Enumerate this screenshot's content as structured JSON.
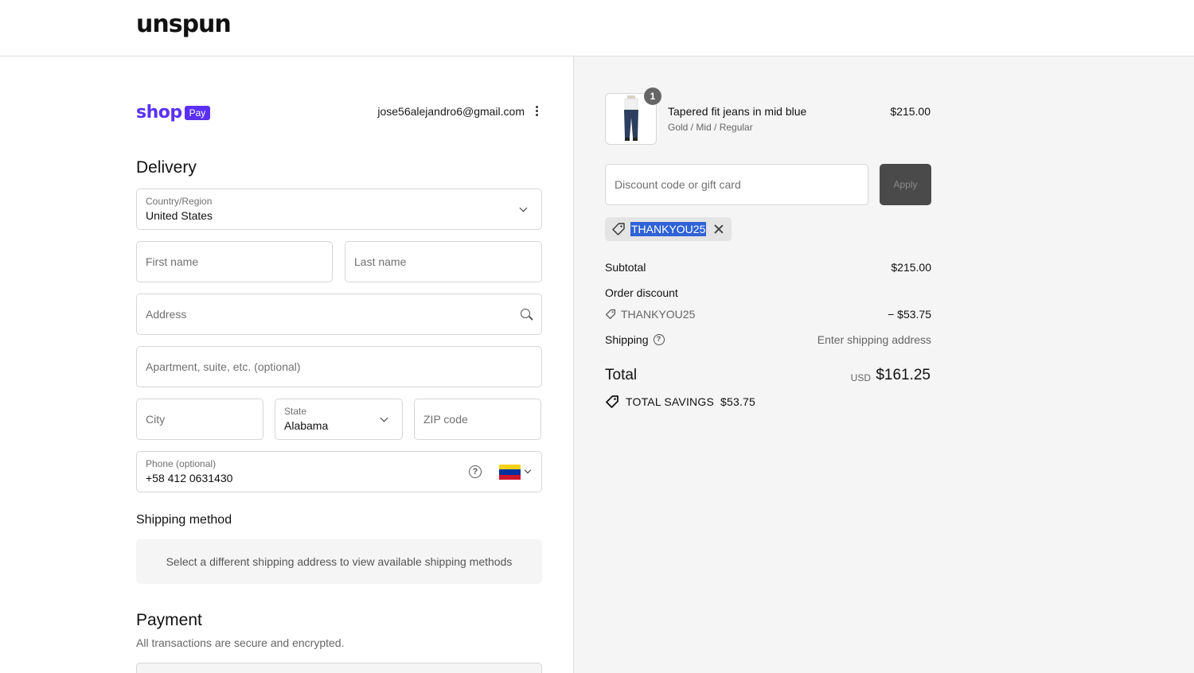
{
  "brand": {
    "logo": "unspun"
  },
  "shop_pay": {
    "shop": "shop",
    "pay": "Pay"
  },
  "account": {
    "email": "jose56alejandro6@gmail.com"
  },
  "delivery": {
    "heading": "Delivery",
    "country": {
      "label": "Country/Region",
      "value": "United States"
    },
    "first_name": {
      "placeholder": "First name"
    },
    "last_name": {
      "placeholder": "Last name"
    },
    "address": {
      "placeholder": "Address"
    },
    "apartment": {
      "placeholder": "Apartment, suite, etc. (optional)"
    },
    "city": {
      "placeholder": "City"
    },
    "state": {
      "label": "State",
      "value": "Alabama"
    },
    "zip": {
      "placeholder": "ZIP code"
    },
    "phone": {
      "label": "Phone (optional)",
      "value": "+58 412 0631430"
    }
  },
  "shipping_method": {
    "heading": "Shipping method",
    "message": "Select a different shipping address to view available shipping methods"
  },
  "payment": {
    "heading": "Payment",
    "subtitle": "All transactions are secure and encrypted."
  },
  "order": {
    "product": {
      "quantity": "1",
      "title": "Tapered fit jeans in mid blue",
      "variant": "Gold / Mid / Regular",
      "price": "$215.00"
    },
    "discount_input": {
      "placeholder": "Discount code or gift card"
    },
    "apply_label": "Apply",
    "applied_code": "THANKYOU25",
    "subtotal": {
      "label": "Subtotal",
      "value": "$215.00"
    },
    "order_discount": {
      "label": "Order discount",
      "code": "THANKYOU25",
      "value": "− $53.75"
    },
    "shipping": {
      "label": "Shipping",
      "value": "Enter shipping address"
    },
    "total": {
      "label": "Total",
      "currency": "USD",
      "value": "$161.25"
    },
    "savings": {
      "label": "TOTAL SAVINGS",
      "value": "$53.75"
    }
  },
  "colors": {
    "shop_pay": "#5a31f4",
    "selection": "#2f62d6",
    "flag_yellow": "#f7d117",
    "flag_blue": "#0033a0",
    "flag_red": "#cf142b"
  }
}
